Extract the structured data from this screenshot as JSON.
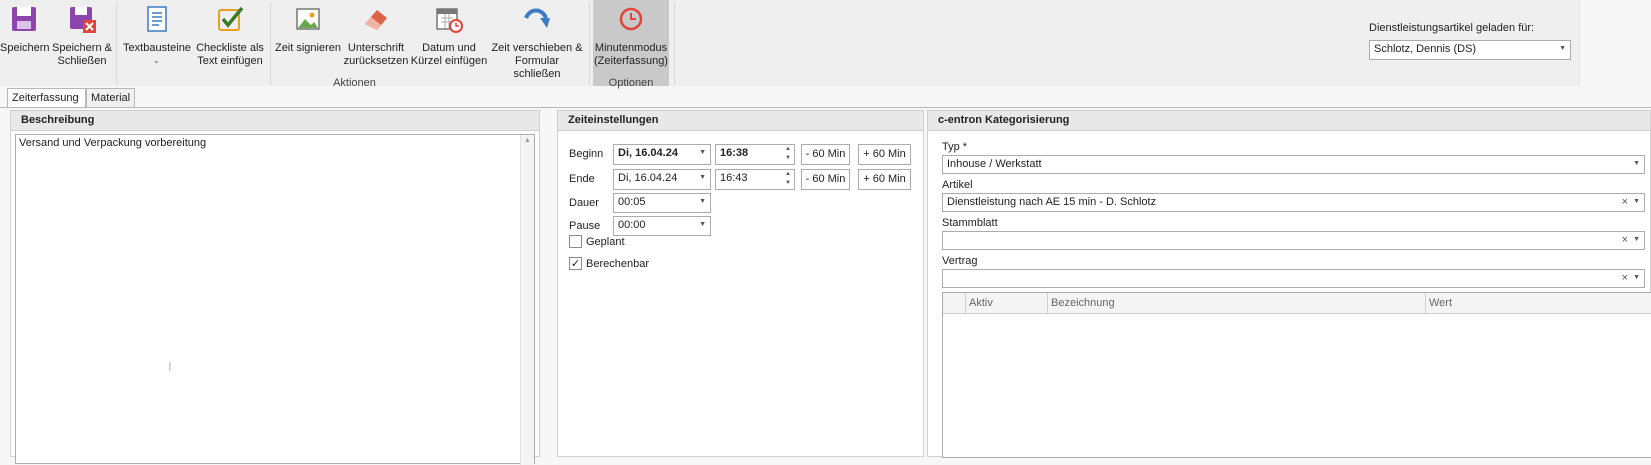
{
  "ribbon": {
    "buttons": {
      "save": "Speichern",
      "save_close": "Speichern &\nSchließen",
      "textblocks": "Textbausteine",
      "checklist": "Checkliste als\nText einfügen",
      "sign_time": "Zeit signieren",
      "reset_signature": "Unterschrift\nzurücksetzen",
      "insert_date": "Datum und\nKürzel einfügen",
      "shift_time": "Zeit verschieben  &\nFormular schließen",
      "minute_mode": "Minutenmodus\n(Zeiterfassung)"
    },
    "groups": {
      "actions": "Aktionen",
      "options": "Optionen"
    },
    "loaded_for_label": "Dienstleistungsartikel geladen für:",
    "loaded_for_value": "Schlotz, Dennis (DS)"
  },
  "tabs": {
    "time_entry": "Zeiterfassung",
    "material": "Material"
  },
  "description": {
    "header": "Beschreibung",
    "text": "Versand und Verpackung vorbereitung"
  },
  "time_settings": {
    "header": "Zeiteinstellungen",
    "begin_label": "Beginn",
    "begin_date": "Di, 16.04.24",
    "begin_time": "16:38",
    "end_label": "Ende",
    "end_date": "Di, 16.04.24",
    "end_time": "16:43",
    "minus60": "- 60 Min",
    "plus60": "+ 60 Min",
    "duration_label": "Dauer",
    "duration_value": "00:05",
    "pause_label": "Pause",
    "pause_value": "00:00",
    "planned_label": "Geplant",
    "planned_checked": false,
    "billable_label": "Berechenbar",
    "billable_checked": true
  },
  "categorization": {
    "header": "c-entron Kategorisierung",
    "type_label": "Typ *",
    "type_value": "Inhouse / Werkstatt",
    "article_label": "Artikel",
    "article_value": "Dienstleistung nach AE 15 min - D. Schlotz",
    "masterdata_label": "Stammblatt",
    "masterdata_value": "",
    "contract_label": "Vertrag",
    "contract_value": "",
    "grid_columns": [
      "Aktiv",
      "Bezeichnung",
      "Wert"
    ]
  },
  "colors": {
    "accent_purple": "#8e44ad",
    "accent_orange": "#e8a020",
    "accent_green": "#3a7a2a",
    "accent_blue": "#3b7dc4",
    "accent_red": "#e0443a"
  }
}
